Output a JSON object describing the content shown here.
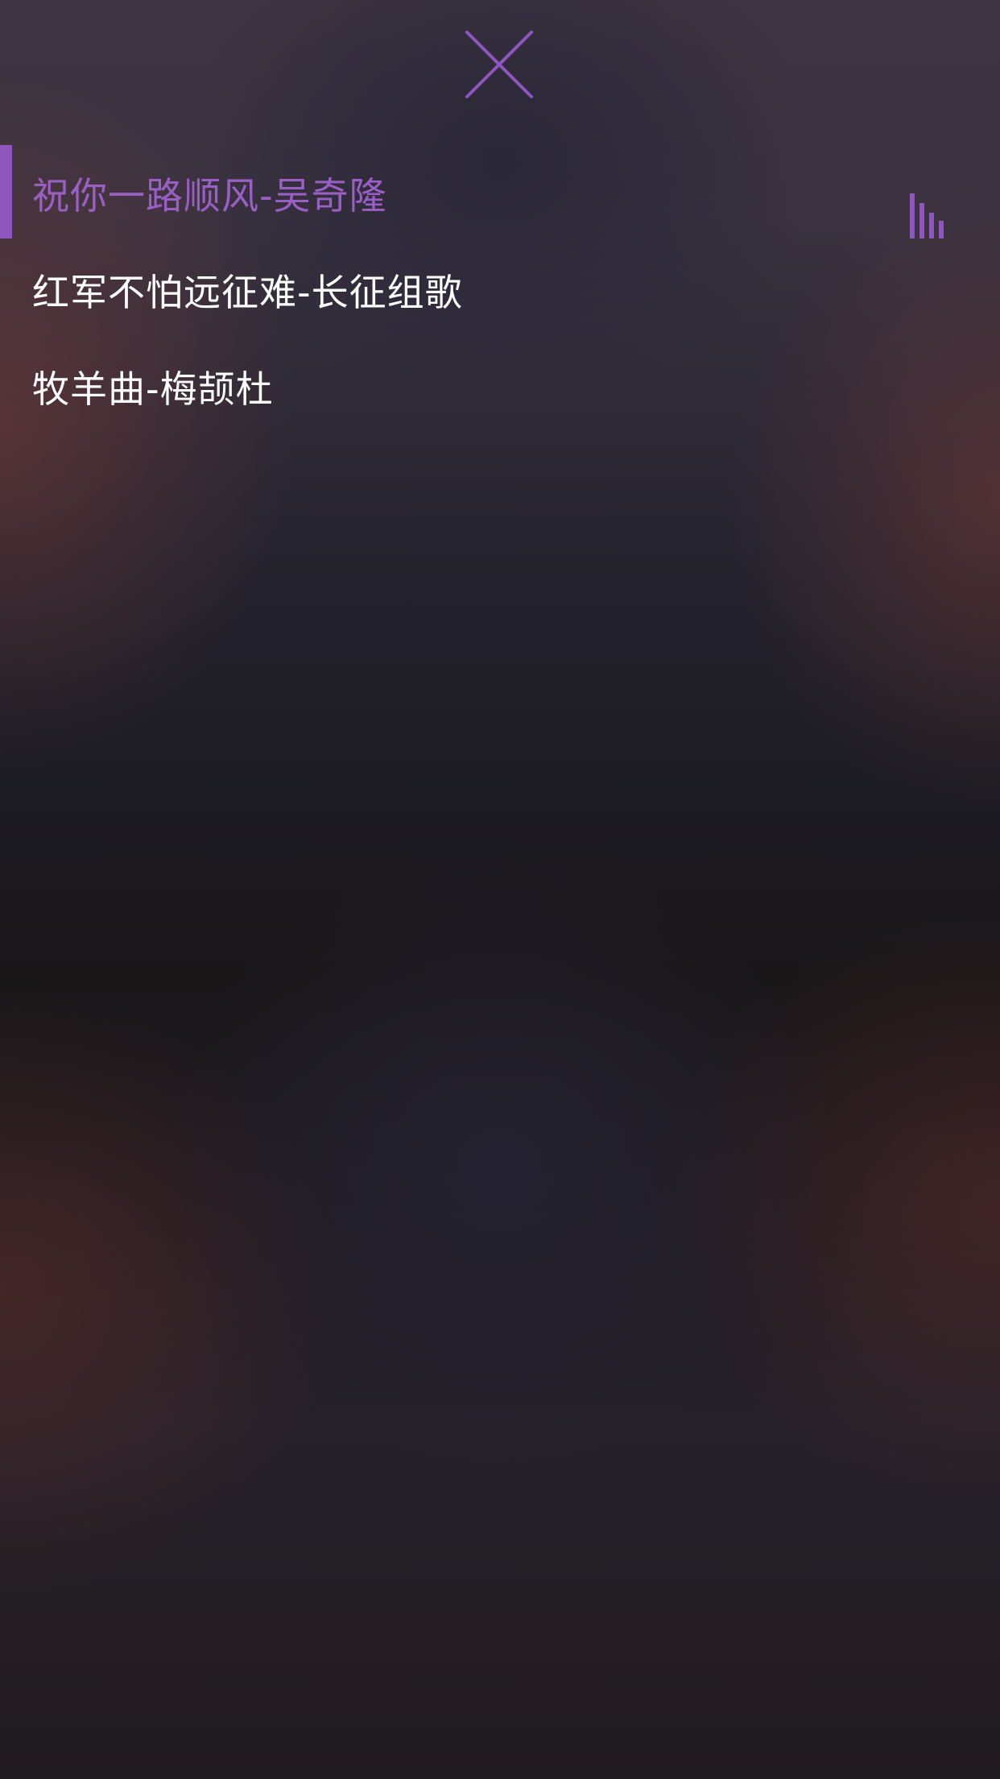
{
  "header": {
    "close_icon": "close-icon"
  },
  "colors": {
    "accent": "#8e55bf",
    "active_text": "#9a5fc4",
    "text": "#ffffff"
  },
  "playlist": {
    "items": [
      {
        "title": "祝你一路顺风-吴奇隆",
        "active": true
      },
      {
        "title": "红军不怕远征难-长征组歌",
        "active": false
      },
      {
        "title": "牧羊曲-梅颉杜",
        "active": false
      }
    ],
    "now_playing_icon": "equalizer-icon"
  }
}
